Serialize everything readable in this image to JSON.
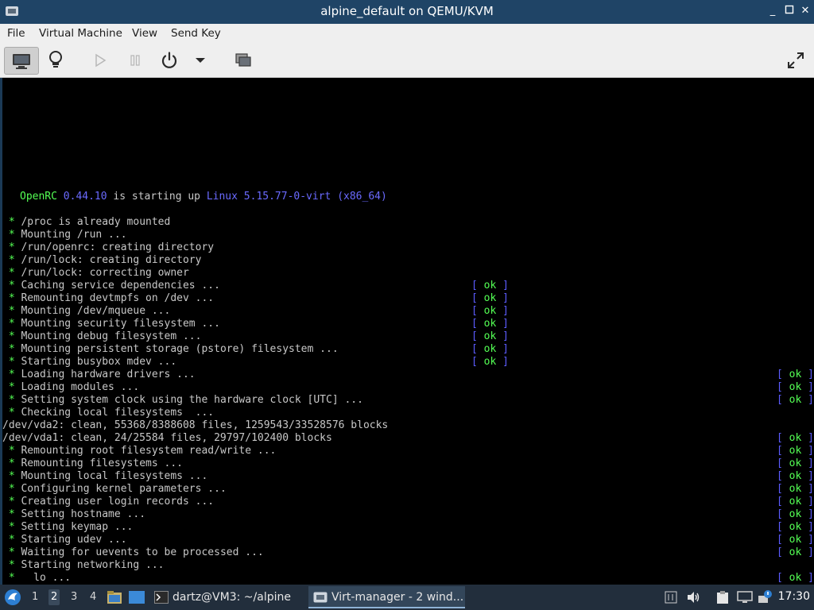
{
  "window": {
    "title": "alpine_default on QEMU/KVM",
    "controls": {
      "minimize": "_",
      "maximize": "□",
      "close": "✕"
    }
  },
  "menubar": {
    "items": [
      "File",
      "Virtual Machine",
      "View",
      "Send Key"
    ]
  },
  "toolbar": {
    "buttons": [
      {
        "icon": "console-monitor-icon",
        "active": true
      },
      {
        "icon": "details-lightbulb-icon",
        "active": false
      },
      {
        "icon": "run-play-icon",
        "active": false,
        "disabled": true
      },
      {
        "icon": "pause-icon",
        "active": false,
        "disabled": true
      },
      {
        "icon": "power-icon",
        "active": false
      },
      {
        "icon": "power-menu-chevron-icon",
        "active": false
      },
      {
        "icon": "snapshots-icon",
        "active": false
      },
      {
        "icon": "fullscreen-icon",
        "active": false
      }
    ]
  },
  "console": {
    "header": {
      "part1": "OpenRC",
      "version": "0.44.10",
      "part2": "is starting up",
      "kernel": "Linux 5.15.77-0-virt (x86_64)"
    },
    "lines": [
      {
        "bullet": "*",
        "text": "/proc is already mounted",
        "ok": ""
      },
      {
        "bullet": "*",
        "text": "Mounting /run ...",
        "ok": ""
      },
      {
        "bullet": "*",
        "text": "/run/openrc: creating directory",
        "ok": ""
      },
      {
        "bullet": "*",
        "text": "/run/lock: creating directory",
        "ok": ""
      },
      {
        "bullet": "*",
        "text": "/run/lock: correcting owner",
        "ok": ""
      },
      {
        "bullet": "*",
        "text": "Caching service dependencies ...",
        "ok": "mid"
      },
      {
        "bullet": "*",
        "text": "Remounting devtmpfs on /dev ...",
        "ok": "mid"
      },
      {
        "bullet": "*",
        "text": "Mounting /dev/mqueue ...",
        "ok": "mid"
      },
      {
        "bullet": "*",
        "text": "Mounting security filesystem ...",
        "ok": "mid"
      },
      {
        "bullet": "*",
        "text": "Mounting debug filesystem ...",
        "ok": "mid"
      },
      {
        "bullet": "*",
        "text": "Mounting persistent storage (pstore) filesystem ...",
        "ok": "mid"
      },
      {
        "bullet": "*",
        "text": "Starting busybox mdev ...",
        "ok": "mid"
      },
      {
        "bullet": "*",
        "text": "Loading hardware drivers ...",
        "ok": "right"
      },
      {
        "bullet": "*",
        "text": "Loading modules ...",
        "ok": "right"
      },
      {
        "bullet": "*",
        "text": "Setting system clock using the hardware clock [UTC] ...",
        "ok": "right"
      },
      {
        "bullet": "*",
        "text": "Checking local filesystems  ...",
        "ok": ""
      },
      {
        "bullet": "",
        "text": "/dev/vda2: clean, 55368/8388608 files, 1259543/33528576 blocks",
        "ok": ""
      },
      {
        "bullet": "",
        "text": "/dev/vda1: clean, 24/25584 files, 29797/102400 blocks",
        "ok": "right"
      },
      {
        "bullet": "*",
        "text": "Remounting root filesystem read/write ...",
        "ok": "right"
      },
      {
        "bullet": "*",
        "text": "Remounting filesystems ...",
        "ok": "right"
      },
      {
        "bullet": "*",
        "text": "Mounting local filesystems ...",
        "ok": "right"
      },
      {
        "bullet": "*",
        "text": "Configuring kernel parameters ...",
        "ok": "right"
      },
      {
        "bullet": "*",
        "text": "Creating user login records ...",
        "ok": "right"
      },
      {
        "bullet": "*",
        "text": "Setting hostname ...",
        "ok": "right"
      },
      {
        "bullet": "*",
        "text": "Setting keymap ...",
        "ok": "right"
      },
      {
        "bullet": "*",
        "text": "Starting udev ...",
        "ok": "right"
      },
      {
        "bullet": "*",
        "text": "Waiting for uevents to be processed ...",
        "ok": "right"
      },
      {
        "bullet": "*",
        "text": "Starting networking ...",
        "ok": ""
      },
      {
        "bullet": "*",
        "text": "  lo ...",
        "ok": "right"
      }
    ],
    "ok_open": "[",
    "ok_text": "ok",
    "ok_close": "]"
  },
  "taskbar": {
    "workspaces": [
      "1",
      "2",
      "3",
      "4"
    ],
    "active_workspace": "2",
    "tasks": [
      {
        "label": "dartz@VM3: ~/alpine",
        "icon": "terminal-icon"
      },
      {
        "label": "Virt-manager - 2 wind...",
        "icon": "virt-manager-icon"
      }
    ],
    "clock": "17:30"
  }
}
